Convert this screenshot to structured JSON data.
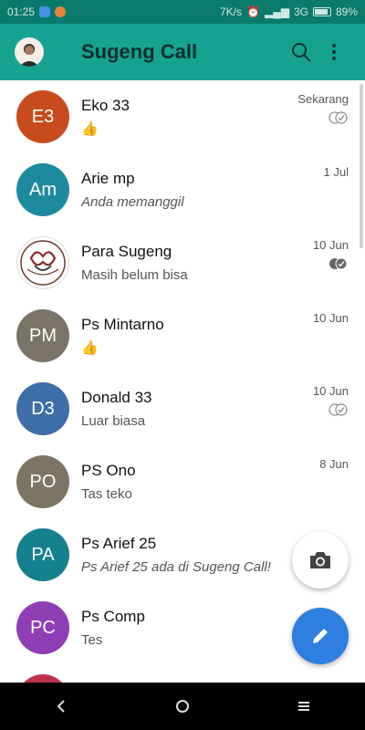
{
  "status_bar": {
    "time": "01:25",
    "net_speed": "7K/s",
    "network": "3G",
    "battery": "89%"
  },
  "app": {
    "title": "Sugeng Call"
  },
  "chats": [
    {
      "initials": "E3",
      "name": "Eko 33",
      "preview": "👍",
      "time": "Sekarang",
      "color": "#c84b1e",
      "italic": false,
      "ticks": "read-outline"
    },
    {
      "initials": "Am",
      "name": "Arie mp",
      "preview": "Anda memanggil",
      "time": "1 Jul",
      "color": "#1e8a9e",
      "italic": true,
      "ticks": ""
    },
    {
      "initials": "",
      "name": "Para Sugeng",
      "preview": "Masih belum bisa",
      "time": "10 Jun",
      "color": "#ffffff",
      "italic": false,
      "ticks": "read-filled"
    },
    {
      "initials": "PM",
      "name": "Ps Mintarno",
      "preview": "👍",
      "time": "10 Jun",
      "color": "#7a7467",
      "italic": false,
      "ticks": ""
    },
    {
      "initials": "D3",
      "name": "Donald 33",
      "preview": "Luar biasa",
      "time": "10 Jun",
      "color": "#3e6ea8",
      "italic": false,
      "ticks": "read-outline"
    },
    {
      "initials": "PO",
      "name": "PS Ono",
      "preview": "Tas teko",
      "time": "8 Jun",
      "color": "#7e7464",
      "italic": false,
      "ticks": ""
    },
    {
      "initials": "PA",
      "name": "Ps Arief 25",
      "preview": "Ps Arief 25 ada di Sugeng Call!",
      "time": "",
      "color": "#15808e",
      "italic": true,
      "ticks": ""
    },
    {
      "initials": "PC",
      "name": "Ps Comp",
      "preview": "Tes",
      "time": "",
      "color": "#8e3fb5",
      "italic": false,
      "ticks": ""
    }
  ],
  "colors": {
    "appbar": "#15a291",
    "statusbar": "#0a7a6c",
    "fab_edit": "#2e7ee0"
  }
}
